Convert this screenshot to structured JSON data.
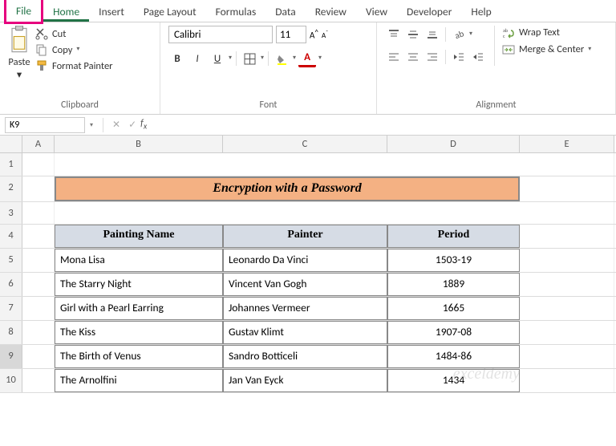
{
  "tabs": [
    "File",
    "Home",
    "Insert",
    "Page Layout",
    "Formulas",
    "Data",
    "Review",
    "View",
    "Developer",
    "Help"
  ],
  "clipboard": {
    "paste": "Paste",
    "cut": "Cut",
    "copy": "Copy",
    "painter": "Format Painter",
    "label": "Clipboard"
  },
  "font": {
    "name": "Calibri",
    "size": "11",
    "label": "Font",
    "bold": "B",
    "italic": "I",
    "underline": "U"
  },
  "align": {
    "wrap": "Wrap Text",
    "merge": "Merge & Center",
    "label": "Alignment"
  },
  "namebox": "K9",
  "columns": [
    "A",
    "B",
    "C",
    "D",
    "E"
  ],
  "title": "Encryption with a Password",
  "headers": [
    "Painting Name",
    "Painter",
    "Period"
  ],
  "rows": [
    {
      "n": "5",
      "d": [
        "Mona Lisa",
        "Leonardo Da Vinci",
        "1503-19"
      ]
    },
    {
      "n": "6",
      "d": [
        "The Starry Night",
        "Vincent Van Gogh",
        "1889"
      ]
    },
    {
      "n": "7",
      "d": [
        "Girl with a Pearl Earring",
        "Johannes Vermeer",
        "1665"
      ]
    },
    {
      "n": "8",
      "d": [
        "The Kiss",
        "Gustav Klimt",
        "1907-08"
      ]
    },
    {
      "n": "9",
      "d": [
        "The Birth of Venus",
        "Sandro Botticeli",
        "1484-86"
      ]
    },
    {
      "n": "10",
      "d": [
        "The Arnolfini",
        "Jan Van Eyck",
        "1434"
      ]
    }
  ],
  "watermark": "exceldemy"
}
